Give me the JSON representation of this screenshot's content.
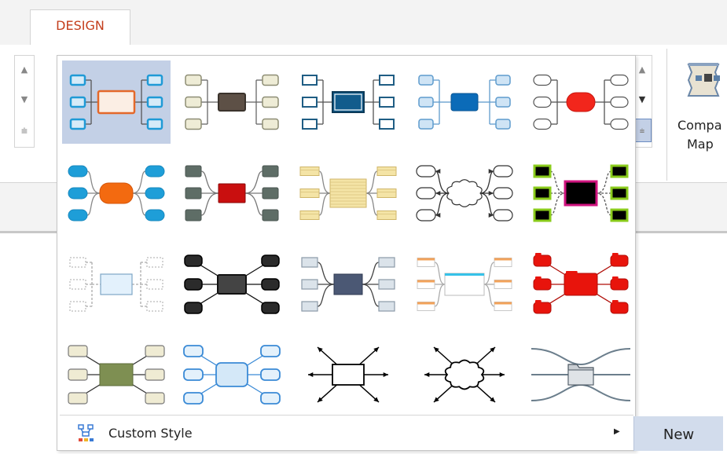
{
  "tabs": {
    "design_label": "DESIGN"
  },
  "gallery": {
    "footer": {
      "custom_style_label": "Custom Style"
    },
    "new_label": "New",
    "selected_index": 0
  },
  "ribbon": {
    "compact_map_label_line1": "Compa",
    "compact_map_label_line2": "Map"
  },
  "icons": [
    "chevron-up-icon",
    "chevron-down-icon",
    "more-icon",
    "custom-style-icon",
    "submenu-arrow-icon",
    "compact-map-icon"
  ],
  "colors": {
    "tab_accent": "#c43e1c",
    "selection": "#c3d0e6",
    "new_button": "#d2dcec"
  }
}
